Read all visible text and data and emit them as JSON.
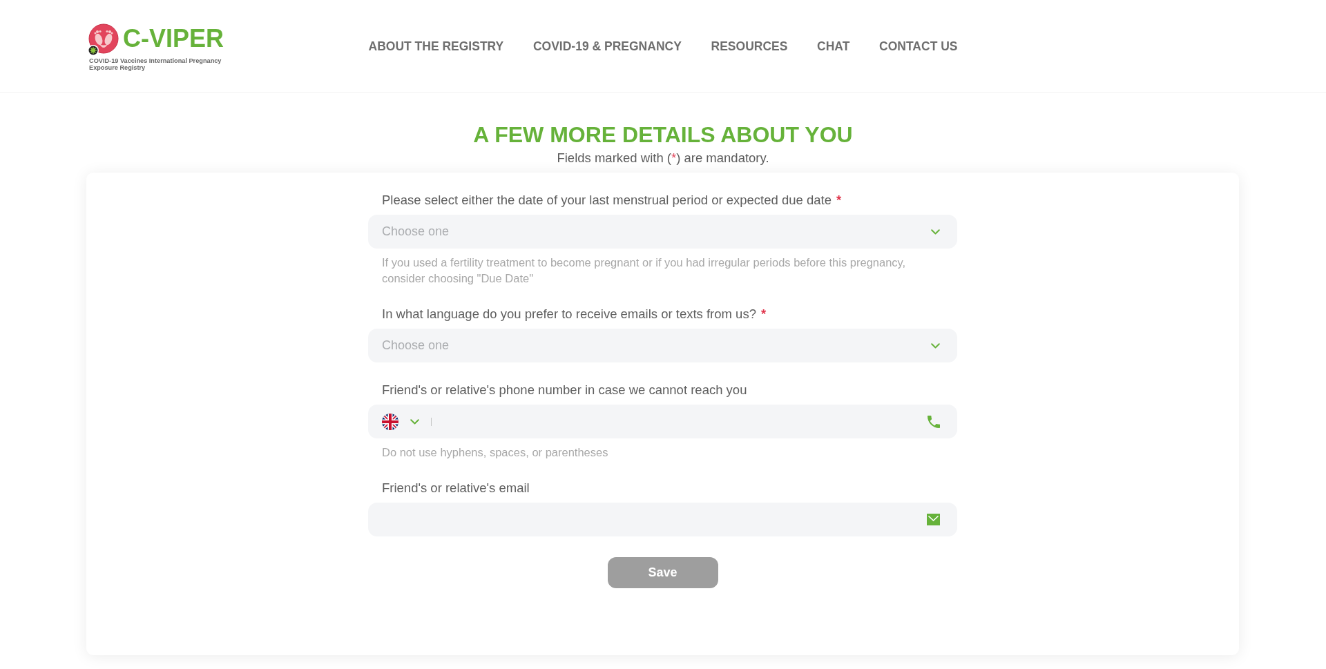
{
  "header": {
    "logo": {
      "name": "C-VIPER",
      "tagline": "COVID-19 Vaccines International Pregnancy Exposure Registry"
    },
    "nav": [
      "ABOUT THE REGISTRY",
      "COVID-19 & PREGNANCY",
      "RESOURCES",
      "CHAT",
      "CONTACT US"
    ]
  },
  "page": {
    "title": "A FEW MORE DETAILS ABOUT YOU",
    "note": {
      "before": "Fields marked with (",
      "mark": "*",
      "after": ") are mandatory."
    }
  },
  "form": {
    "fields": [
      {
        "kind": "select",
        "label": "Please select either the date of your last menstrual period or expected due date",
        "required_mark": "*",
        "placeholder": "Choose one",
        "help": "If you used a fertility treatment to become pregnant or if you had irregular periods before this pregnancy, consider choosing \"Due Date\""
      },
      {
        "kind": "select",
        "label": "In what language do you prefer to receive emails or texts from us?",
        "required_mark": "*",
        "placeholder": "Choose one"
      },
      {
        "kind": "phone",
        "label": "Friend's or relative's phone number in case we cannot reach you",
        "help": "Do not use hyphens, spaces, or parentheses"
      },
      {
        "kind": "email",
        "label": "Friend's or relative's email"
      }
    ],
    "save_button": {
      "label": "Save",
      "disabled": true
    }
  }
}
